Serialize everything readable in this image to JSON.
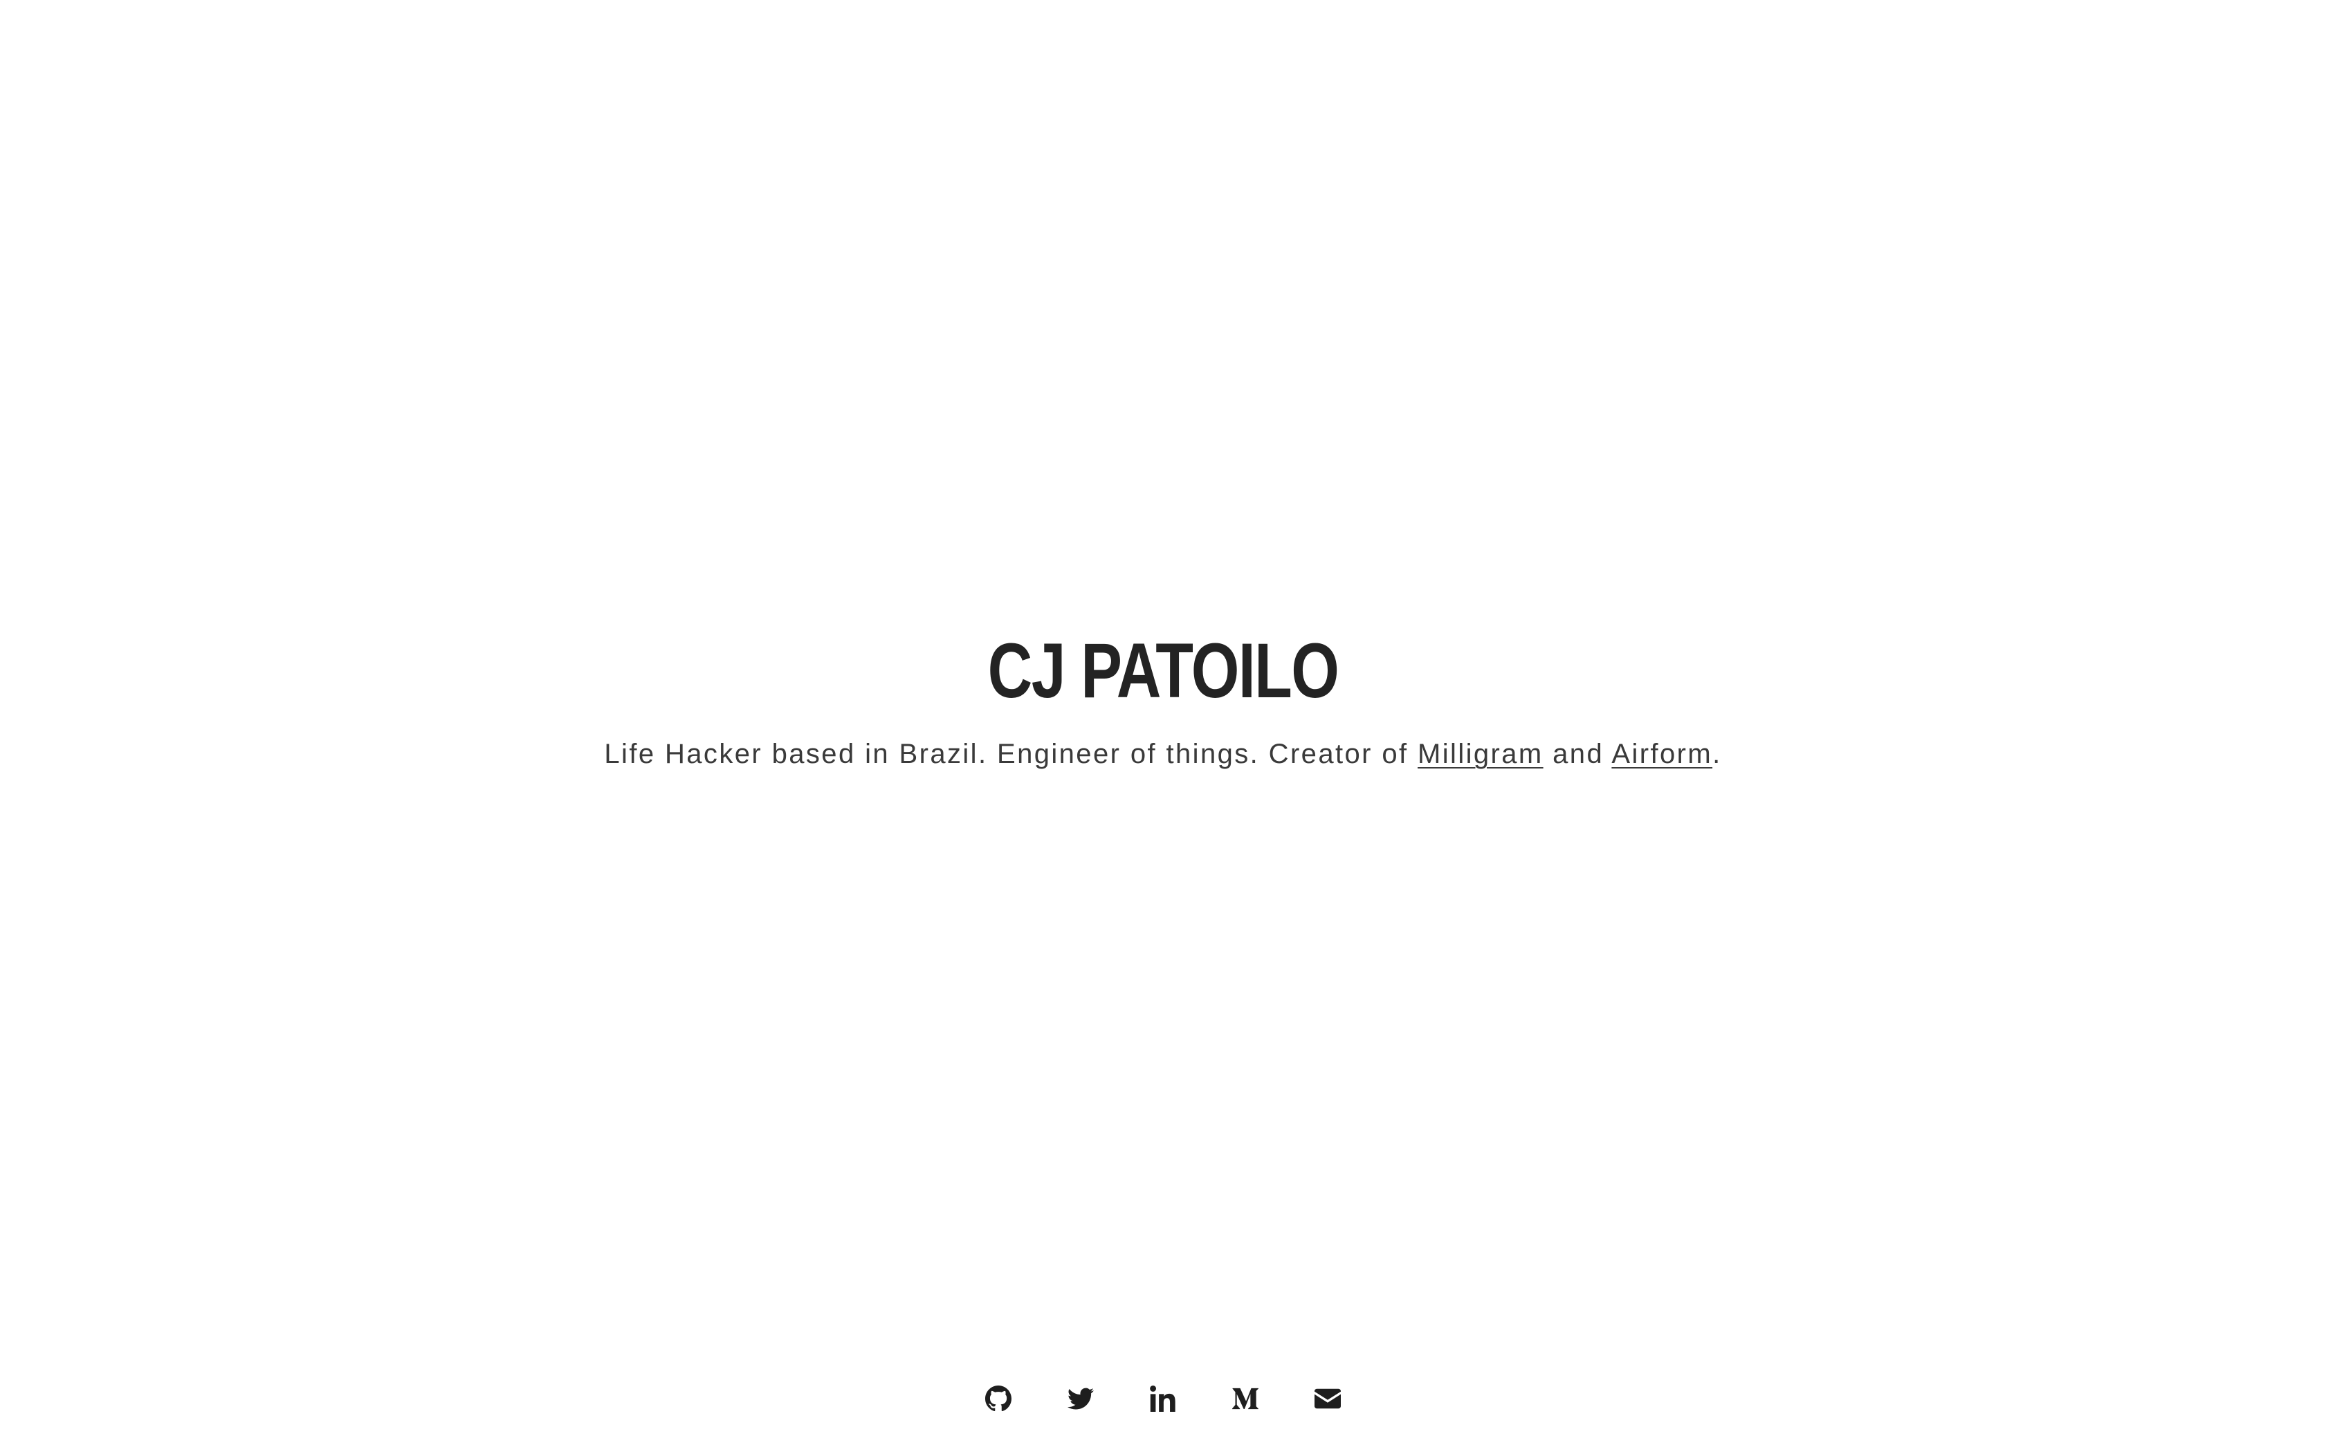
{
  "profile": {
    "name": "CJ PATOILO",
    "tagline_start": "Life Hacker based in Brazil. Engineer of things. Creator of ",
    "link1": "Milligram",
    "tagline_middle": " and ",
    "link2": "Airform",
    "tagline_end": "."
  },
  "social": [
    {
      "icon": "github-icon",
      "label": "GitHub"
    },
    {
      "icon": "twitter-icon",
      "label": "Twitter"
    },
    {
      "icon": "linkedin-icon",
      "label": "LinkedIn"
    },
    {
      "icon": "medium-icon",
      "label": "Medium"
    },
    {
      "icon": "envelope-icon",
      "label": "Email"
    }
  ],
  "colors": {
    "background": "#ffffff",
    "text": "#232323"
  }
}
